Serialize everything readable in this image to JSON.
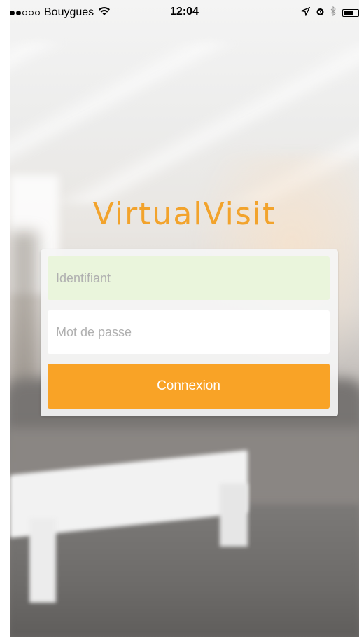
{
  "status_bar": {
    "signal_dots": [
      true,
      true,
      false,
      false,
      false
    ],
    "carrier": "Bouygues",
    "wifi_icon": "wifi-icon",
    "time": "12:04",
    "icons": [
      "location-arrow-icon",
      "alarm-icon",
      "bluetooth-icon",
      "battery-icon"
    ],
    "battery_level": 0.7
  },
  "app": {
    "title": "VirtualVisit",
    "accent_color": "#f9a326"
  },
  "login": {
    "username_placeholder": "Identifiant",
    "username_value": "",
    "password_placeholder": "Mot de passe",
    "password_value": "",
    "submit_label": "Connexion"
  }
}
